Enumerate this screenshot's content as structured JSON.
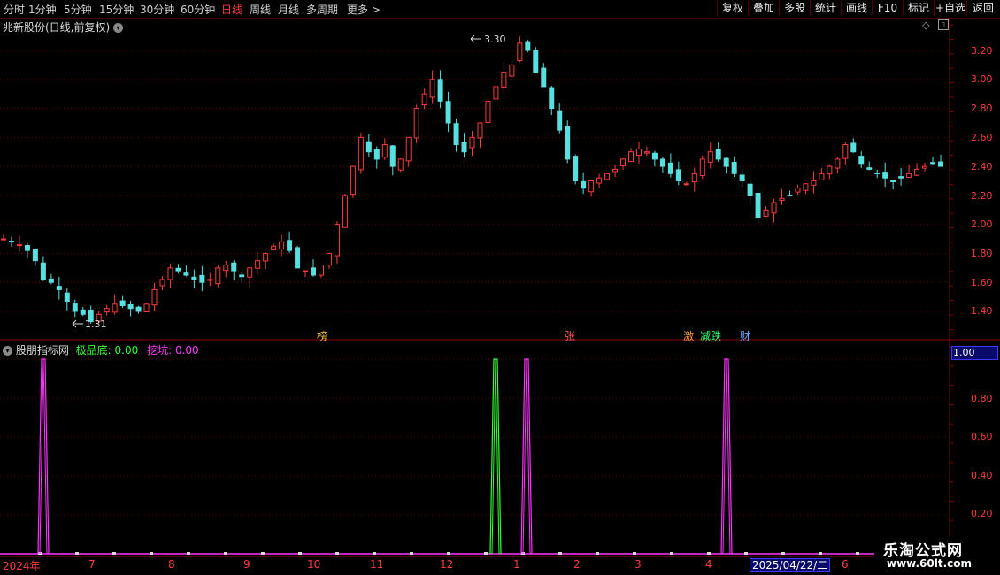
{
  "toolbar": {
    "timeframes": [
      "分时",
      "1分钟",
      "5分钟",
      "15分钟",
      "30分钟",
      "60分钟",
      "日线",
      "周线",
      "月线",
      "多周期",
      "更多 >"
    ],
    "active_timeframe": "日线",
    "right_buttons": [
      "复权",
      "叠加",
      "多股",
      "统计",
      "画线",
      "F10",
      "标记",
      "+自选",
      "返回"
    ]
  },
  "main_chart": {
    "title": "兆新股份(日线,前复权)",
    "price_labels": [
      "3.20",
      "3.00",
      "2.80",
      "2.60",
      "2.40",
      "2.20",
      "2.00",
      "1.80",
      "1.60",
      "1.40"
    ],
    "high_marker": "3.30",
    "low_marker": "1.31",
    "event_tags": [
      "榜",
      "张",
      "激",
      "减跌",
      "财"
    ]
  },
  "indicator": {
    "name": "股朋指标网",
    "series1_label": "极品底:",
    "series1_value": "0.00",
    "series2_label": "挖坑:",
    "series2_value": "0.00",
    "y_labels": [
      "1.00",
      "0.80",
      "0.60",
      "0.40",
      "0.20"
    ],
    "current_value": "1.00"
  },
  "x_axis": {
    "labels": [
      "2024年",
      "7",
      "8",
      "9",
      "10",
      "11",
      "12",
      "1",
      "2",
      "3",
      "4",
      "6"
    ],
    "cursor_date": "2025/04/22/二"
  },
  "watermark": {
    "line1": "乐淘公式网",
    "line2": "www.60lt.com"
  },
  "colors": {
    "up": "#ff3b3b",
    "down": "#56e0e0",
    "grid": "#6a0000",
    "series1": "#33ff33",
    "series2": "#ff33ff"
  },
  "chart_data": {
    "type": "candlestick",
    "price_axis": {
      "min": 1.31,
      "max": 3.3,
      "ticks": [
        1.4,
        1.6,
        1.8,
        2.0,
        2.2,
        2.4,
        2.6,
        2.8,
        3.0,
        3.2
      ]
    },
    "closes_approx": [
      1.9,
      1.88,
      1.86,
      1.82,
      1.75,
      1.62,
      1.6,
      1.55,
      1.47,
      1.4,
      1.38,
      1.33,
      1.38,
      1.42,
      1.45,
      1.44,
      1.42,
      1.4,
      1.45,
      1.55,
      1.62,
      1.7,
      1.68,
      1.65,
      1.62,
      1.6,
      1.62,
      1.7,
      1.72,
      1.68,
      1.64,
      1.7,
      1.75,
      1.8,
      1.85,
      1.88,
      1.82,
      1.7,
      1.68,
      1.65,
      1.72,
      1.8,
      2.0,
      2.2,
      2.4,
      2.6,
      2.5,
      2.45,
      2.55,
      2.4,
      2.45,
      2.6,
      2.8,
      2.9,
      3.0,
      2.85,
      2.7,
      2.55,
      2.5,
      2.6,
      2.7,
      2.85,
      2.95,
      3.05,
      3.1,
      3.25,
      3.2,
      3.05,
      2.95,
      2.8,
      2.65,
      2.45,
      2.3,
      2.25,
      2.3,
      2.32,
      2.35,
      2.38,
      2.45,
      2.5,
      2.52,
      2.5,
      2.45,
      2.4,
      2.35,
      2.3,
      2.28,
      2.35,
      2.45,
      2.5,
      2.45,
      2.4,
      2.35,
      2.3,
      2.2,
      2.05,
      2.1,
      2.15,
      2.18,
      2.2,
      2.25,
      2.28,
      2.3,
      2.35,
      2.4,
      2.45,
      2.55,
      2.5,
      2.42,
      2.38,
      2.35,
      2.32,
      2.3,
      2.32,
      2.35,
      2.38,
      2.4,
      2.42,
      2.4
    ],
    "indicator_axis": {
      "min": 0,
      "max": 1,
      "ticks": [
        0.2,
        0.4,
        0.6,
        0.8,
        1.0
      ]
    },
    "series": [
      {
        "name": "极品底",
        "spikes_at_month": [
          "12"
        ]
      },
      {
        "name": "挖坑",
        "spikes_at_month": [
          "2024年",
          "12",
          "4"
        ]
      }
    ]
  }
}
